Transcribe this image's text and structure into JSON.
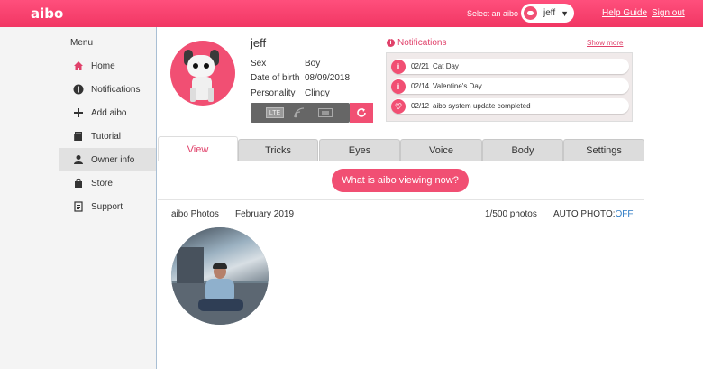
{
  "header": {
    "logo": "aibo",
    "select_label": "Select an aibo",
    "selected_aibo": "jeff",
    "help_link": "Help Guide",
    "signout_link": "Sign out"
  },
  "sidebar": {
    "title": "Menu",
    "items": [
      {
        "label": "Home",
        "icon": "home-icon"
      },
      {
        "label": "Notifications",
        "icon": "info-icon"
      },
      {
        "label": "Add aibo",
        "icon": "plus-icon"
      },
      {
        "label": "Tutorial",
        "icon": "book-icon"
      },
      {
        "label": "Owner info",
        "icon": "person-icon",
        "active": true
      },
      {
        "label": "Store",
        "icon": "shopping-bag-icon"
      },
      {
        "label": "Support",
        "icon": "document-icon"
      }
    ]
  },
  "profile": {
    "name": "jeff",
    "sex_label": "Sex",
    "sex_value": "Boy",
    "dob_label": "Date of birth",
    "dob_value": "08/09/2018",
    "personality_label": "Personality",
    "personality_value": "Clingy",
    "lte_label": "LTE"
  },
  "notifications": {
    "title": "Notifications",
    "show_more": "Show more",
    "items": [
      {
        "date": "02/21",
        "text": "Cat Day",
        "icon": "info-icon"
      },
      {
        "date": "02/14",
        "text": "Valentine's Day",
        "icon": "info-icon"
      },
      {
        "date": "02/12",
        "text": "aibo system update completed",
        "icon": "heart-icon"
      }
    ]
  },
  "tabs": [
    {
      "label": "View",
      "active": true
    },
    {
      "label": "Tricks"
    },
    {
      "label": "Eyes"
    },
    {
      "label": "Voice"
    },
    {
      "label": "Body"
    },
    {
      "label": "Settings"
    }
  ],
  "view": {
    "button_label": "What is aibo viewing now?",
    "photos_label": "aibo Photos",
    "month": "February 2019",
    "count": "1/500 photos",
    "auto_photo_label": "AUTO PHOTO:",
    "auto_photo_value": "OFF"
  },
  "colors": {
    "brand": "#f14f73",
    "link_blue": "#2e7bc4"
  }
}
